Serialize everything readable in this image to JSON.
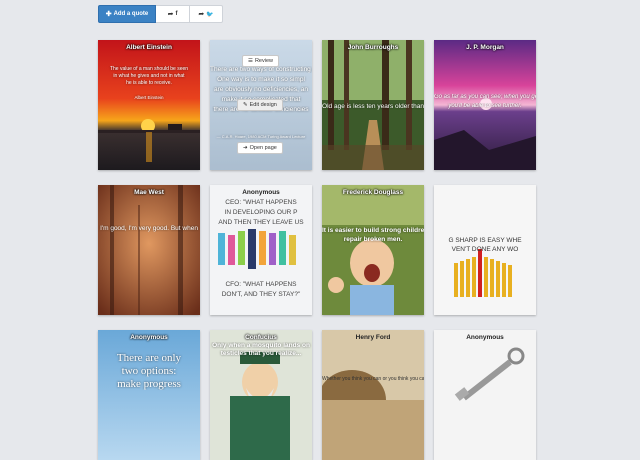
{
  "toolbar": {
    "add_quote_label": "Add a quote",
    "add_icon": "plus-icon",
    "share_facebook_icon": "share-facebook-icon",
    "share_twitter_icon": "share-twitter-icon",
    "accent": "#3b82c4"
  },
  "cards": [
    {
      "author": "Albert Einstein",
      "quote_lines": [
        "The value of a man should be seen",
        "in what he gives and not in what",
        "he is able to receive."
      ],
      "signature": "Albert Einstein"
    },
    {
      "author": "",
      "quote_lines": [
        "There are two ways of constructing a s",
        "One way is to make it so simpl",
        "are obviously no deficiencies, an",
        "make it so complicated that",
        "there are no obvious deficiencies"
      ],
      "attribution": "— C.A.R. Hoare, 1980 ACM Turing Award Lecture",
      "overlay": {
        "review": "Review",
        "edit_design": "Edit design",
        "open_page": "Open page"
      }
    },
    {
      "author": "John Burroughs",
      "quote_lines": [
        "Old age is less ten years older than"
      ]
    },
    {
      "author": "J. P. Morgan",
      "quote_lines": [
        "Go as far as you can see; when you get there",
        "you'll be able to see further."
      ]
    },
    {
      "author": "Mae West",
      "quote_lines": [
        "I'm good, I'm very good. But when"
      ]
    },
    {
      "author": "Anonymous",
      "quote_lines": [
        "CEO: \"WHAT HAPPENS",
        "IN DEVELOPING OUR P",
        "AND THEN THEY LEAVE US",
        "CFO: \"WHAT HAPPENS",
        "DON'T, AND THEY STAY?\""
      ]
    },
    {
      "author": "Frederick Douglass",
      "quote_lines": [
        "It is easier to build strong children tha",
        "repair broken men."
      ]
    },
    {
      "author": "",
      "quote_lines": [
        "G SHARP IS EASY WHE",
        "VEN'T DONE ANY WO"
      ]
    },
    {
      "author": "Anonymous",
      "quote_lines": [
        "There are only",
        "two options:",
        "make progress"
      ]
    },
    {
      "author": "Confucius",
      "quote_lines": [
        "Only when a mosquito lands on",
        "testicles that you realize..."
      ]
    },
    {
      "author": "Henry Ford",
      "quote_lines": [
        "Whether you think you can or you think you can't"
      ]
    },
    {
      "author": "Anonymous",
      "quote_lines": []
    }
  ]
}
